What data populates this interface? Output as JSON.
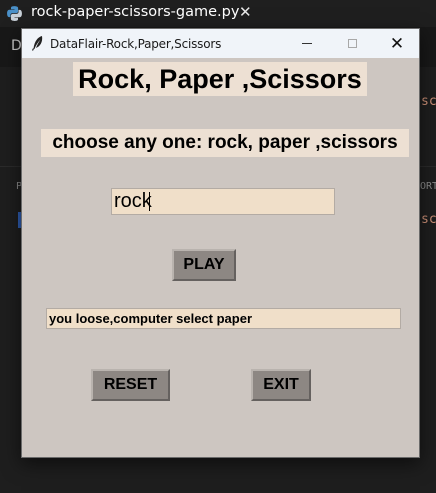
{
  "editor": {
    "tab_title": "rock-paper-scissors-game.py",
    "tab_close_glyph": "✕",
    "bg_fragments": [
      "D",
      "P",
      "ORT",
      "sc",
      "sc"
    ]
  },
  "window": {
    "title": "DataFlair-Rock,Paper,Scissors",
    "min_icon": "minimize-icon",
    "max_icon": "maximize-icon",
    "close_glyph": "✕"
  },
  "app": {
    "heading": "Rock, Paper ,Scissors",
    "prompt": "choose any one: rock, paper ,scissors",
    "entry_value": "rock",
    "play_label": "PLAY",
    "result_text": "you loose,computer select paper",
    "reset_label": "RESET",
    "exit_label": "EXIT"
  },
  "colors": {
    "window_bg": "#cdc6c1",
    "label_bg": "#ede0d3",
    "entry_bg": "#f0dfc9",
    "button_bg": "#8d8783"
  }
}
